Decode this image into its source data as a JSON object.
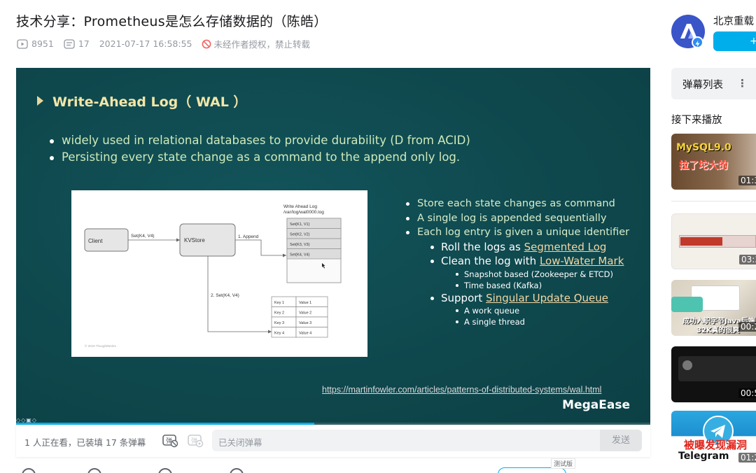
{
  "video": {
    "title": "技术分享：Prometheus是怎么存储数据的（陈皓）",
    "views": "8951",
    "danmaku_count": "17",
    "published": "2021-07-17 16:58:55",
    "copyright_notice": "未经作者授权，禁止转载"
  },
  "slide": {
    "title": "Write-Ahead Log（ WAL ）",
    "bullets": [
      "widely used in relational databases to provide durability (D from ACID)",
      "Persisting every state change as a command to the append only log."
    ],
    "diagram": {
      "client": "Client",
      "set_label": "Set(K4, V4)",
      "kvstore": "KVStore",
      "append": "1. Append",
      "wal_title": "Write Ahead Log",
      "wal_path": "/var/log/wal0000.log",
      "wal_entries": [
        "Set(K1, V1)",
        "Set(K2, V2)",
        "Set(K3, V3)",
        "Set(K4, V4)"
      ],
      "set_step": "2. Set(K4, V4)",
      "table_keys": [
        "Key 1",
        "Key 2",
        "Key 3",
        "Key 4"
      ],
      "table_values": [
        "Value 1",
        "Value 2",
        "Value 3",
        "Value 4"
      ],
      "copyright": "© 2019 ThoughtWorks"
    },
    "right_list": {
      "item1": "Store each state changes as command",
      "item2": "A single log is appended sequentially",
      "item3": "Each log entry is given a unique identifier",
      "roll_prefix": "Roll the logs as ",
      "roll_link": "Segmented Log",
      "clean_prefix": "Clean the log with ",
      "clean_link": "Low-Water Mark",
      "clean_sub1": "Snapshot based (Zookeeper & ETCD)",
      "clean_sub2": "Time based (Kafka)",
      "support_prefix": "Support ",
      "support_link": "Singular Update Queue",
      "support_sub1": "A work queue",
      "support_sub2": "A single thread"
    },
    "source_url": "https://martinfowler.com/articles/patterns-of-distributed-systems/wal.html",
    "brand": "MegaEase",
    "progress_fraction": 0.47
  },
  "danmaku_bar": {
    "status": "1 人正在看，已装填 17 条弹幕",
    "input_placeholder": "已关闭弹幕",
    "send_label": "发送",
    "beta_badge": "测试版"
  },
  "uploader": {
    "name": "北京重载",
    "follow_label": "+"
  },
  "sidebar": {
    "danmaku_list_label": "弹幕列表",
    "more_glyph": "⋮",
    "up_next_label": "接下来播放",
    "thumbnails": [
      {
        "text": "MySQL9.0",
        "subtext": "拉了坨大的",
        "duration": "01:3"
      },
      {
        "text": "",
        "subtext": "",
        "duration": "03:3"
      },
      {
        "text": "成功入职字节Java后端",
        "subtext": "32K真的很爽",
        "duration": "00:2"
      },
      {
        "text": "",
        "subtext": "",
        "duration": "00:5"
      },
      {
        "text": "被曝发现漏洞",
        "subtext": "Telegram",
        "duration": "01:2"
      }
    ]
  },
  "colors": {
    "accent": "#00aeec",
    "slide_bg": "#0f4a4f",
    "slide_title": "#f3e6a8",
    "slide_text": "#cfe9b9"
  }
}
